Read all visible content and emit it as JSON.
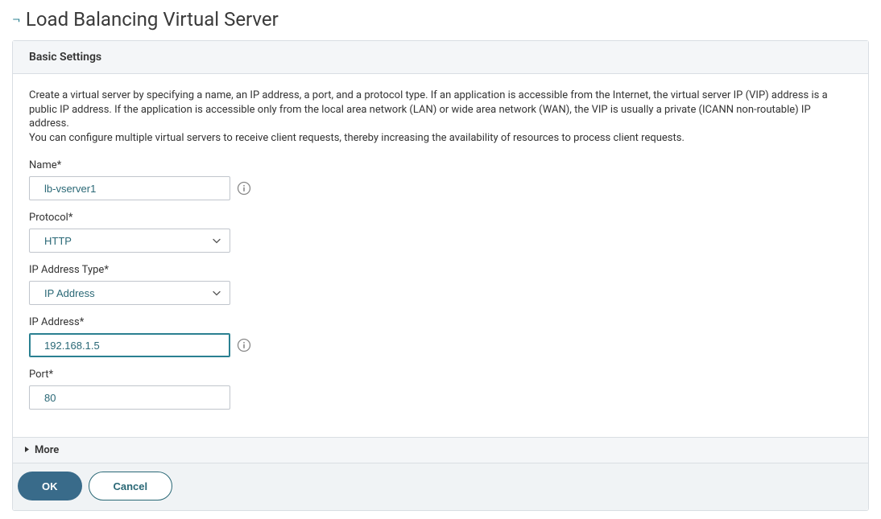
{
  "header": {
    "title": "Load Balancing Virtual Server"
  },
  "panel": {
    "title": "Basic Settings",
    "description_line1": "Create a virtual server by specifying a name, an IP address, a port, and a protocol type. If an application is accessible from the Internet, the virtual server IP (VIP) address is a public IP address. If the application is accessible only from the local area network (LAN) or wide area network (WAN), the VIP is usually a private (ICANN non-routable) IP address.",
    "description_line2": "You can configure multiple virtual servers to receive client requests, thereby increasing the availability of resources to process client requests."
  },
  "form": {
    "name": {
      "label": "Name*",
      "value": "lb-vserver1"
    },
    "protocol": {
      "label": "Protocol*",
      "value": "HTTP"
    },
    "ip_address_type": {
      "label": "IP Address Type*",
      "value": "IP Address"
    },
    "ip_address": {
      "label": "IP Address*",
      "value": "192.168.1.5"
    },
    "port": {
      "label": "Port*",
      "value": "80"
    }
  },
  "more": {
    "label": "More"
  },
  "footer": {
    "ok": "OK",
    "cancel": "Cancel"
  }
}
